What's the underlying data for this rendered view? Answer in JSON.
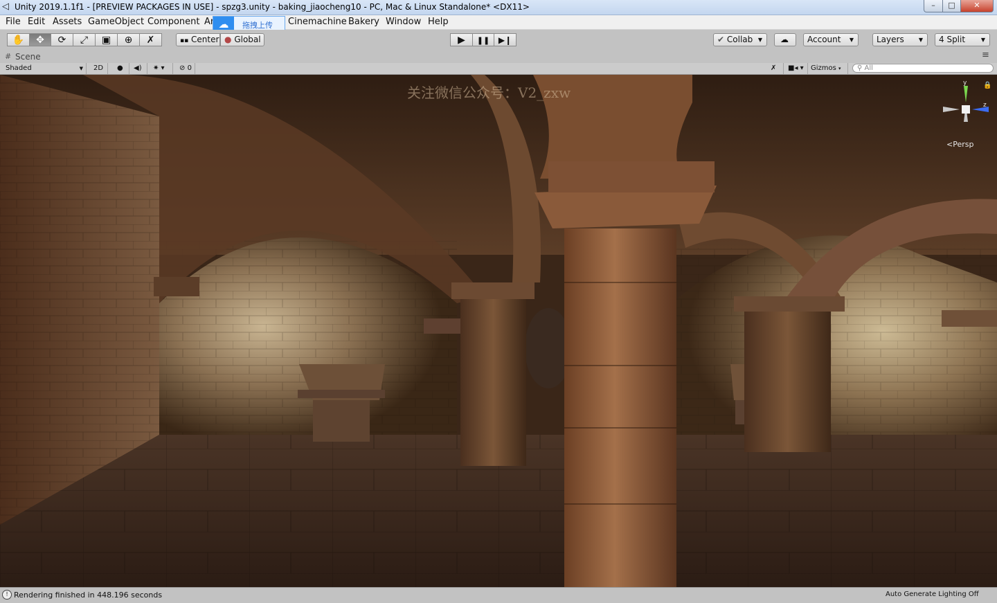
{
  "window": {
    "title": "Unity 2019.1.1f1 - [PREVIEW PACKAGES IN USE] - spzg3.unity - baking_jiaocheng10 - PC, Mac & Linux Standalone* <DX11>",
    "icons": {
      "app": "unity-logo-icon",
      "minimize": "minimize-icon",
      "maximize": "maximize-icon",
      "close": "close-icon"
    },
    "glyphs": {
      "minimize": "–",
      "maximize": "□",
      "close": "✕"
    }
  },
  "menu": {
    "items": [
      "File",
      "Edit",
      "Assets",
      "GameObject",
      "Component",
      "Ar",
      "Cinemachine",
      "Bakery",
      "Window",
      "Help"
    ]
  },
  "upload_overlay": {
    "label": "拖拽上传",
    "icon": "baidu-cloud-icon",
    "accent": "#2f8ef0"
  },
  "toolbar": {
    "transform_tools": [
      "hand-tool-icon",
      "move-tool-icon",
      "rotate-tool-icon",
      "scale-tool-icon",
      "rect-tool-icon",
      "transform-tool-icon",
      "custom-tool-icon"
    ],
    "transform_glyphs": [
      "✋",
      "✥",
      "⟳",
      "⤢",
      "▣",
      "⊕",
      "✗"
    ],
    "active_tool": "move-tool-icon",
    "pivot_label": "Center",
    "space_label": "Global",
    "play_icons": [
      "play-icon",
      "pause-icon",
      "step-icon"
    ],
    "play_glyphs": [
      "▶",
      "❚❚",
      "▶❙"
    ],
    "collab_label": "Collab",
    "cloud_icon": "cloud-icon",
    "account_label": "Account",
    "layers_label": "Layers",
    "layout_label": "4 Split"
  },
  "scene": {
    "tab_label": "Scene",
    "shading_mode": "Shaded",
    "mode_2d": "2D",
    "toggles": [
      "light-icon",
      "audio-icon",
      "effects-icon"
    ],
    "toggle_glyphs": [
      "💡",
      "🔊",
      "☰"
    ],
    "hidden_count": "0",
    "gizmos_label": "Gizmos",
    "search_placeholder": "All",
    "persp_label": "Persp",
    "axis_labels": {
      "y": "y",
      "z": "z"
    },
    "watermark": "关注微信公众号：V2_zxw"
  },
  "status": {
    "message": "Rendering finished in 448.196 seconds",
    "lighting": "Auto Generate Lighting Off"
  }
}
